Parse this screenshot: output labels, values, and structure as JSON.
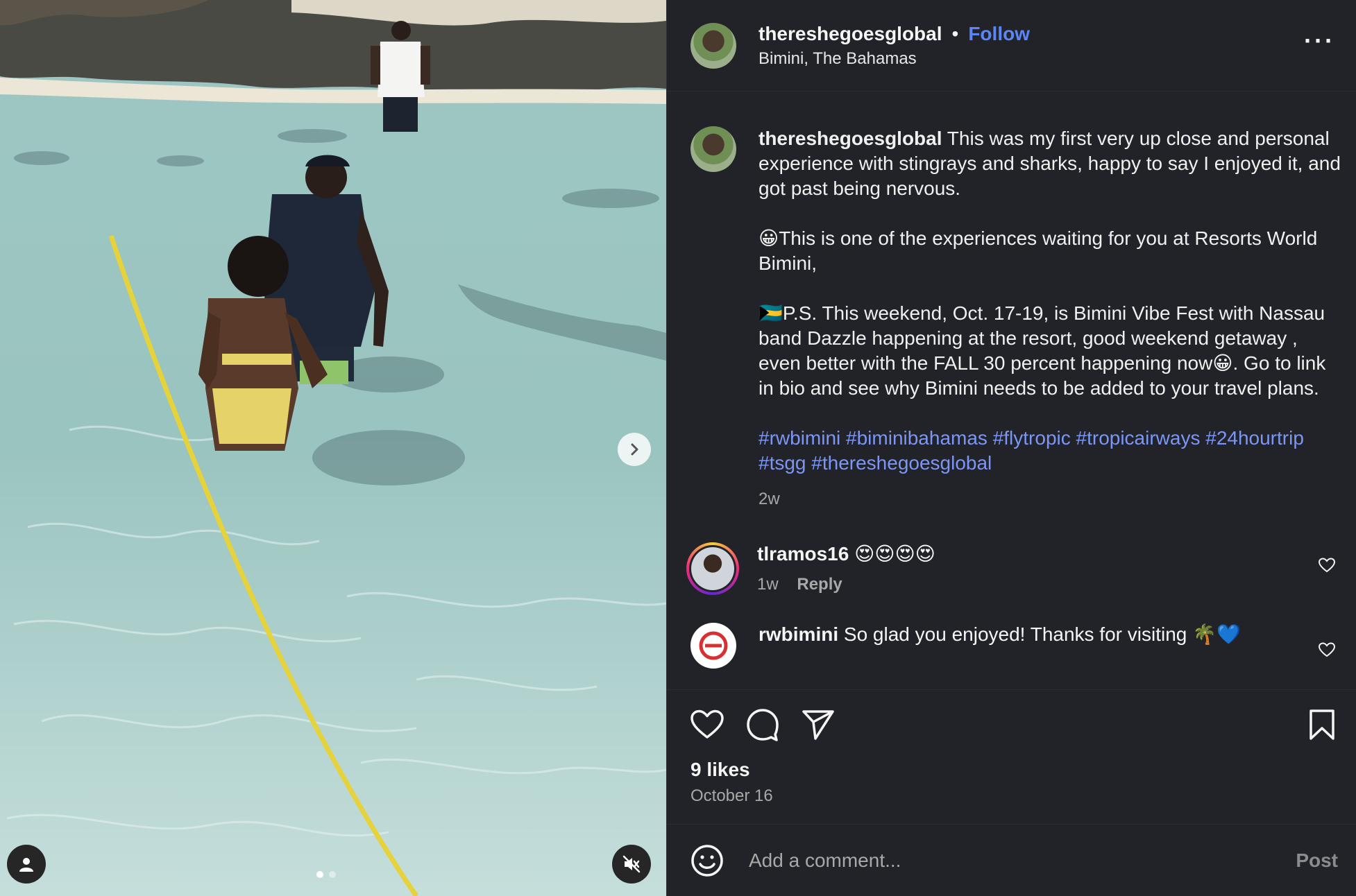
{
  "header": {
    "username": "thereshegoesglobal",
    "separator": "•",
    "follow_label": "Follow",
    "location": "Bimini, The Bahamas",
    "more_icon": "more-horizontal-icon"
  },
  "caption": {
    "username": "thereshegoesglobal",
    "p1": "This was my first very up close and personal experience with stingrays and sharks, happy to say I enjoyed it, and got past being nervous.",
    "p2": "😀This is one of the experiences waiting for you at Resorts World Bimini,",
    "p3": "🇧🇸P.S. This weekend, Oct. 17-19, is Bimini Vibe Fest with Nassau band Dazzle happening at the resort, good weekend getaway , even better with the FALL 30 percent happening now😀. Go to link in bio and see why Bimini needs to be added to your travel plans.",
    "hashtags": "#rwbimini #biminibahamas #flytropic #tropicairways #24hourtrip #tsgg #thereshegoesglobal",
    "time": "2w"
  },
  "comments": [
    {
      "username": "tlramos16",
      "text": "😍😍😍😍",
      "time": "1w",
      "reply_label": "Reply"
    },
    {
      "username": "rwbimini",
      "text": "So glad you enjoyed! Thanks for visiting 🌴💙"
    }
  ],
  "actions": {
    "like_icon": "heart-icon",
    "comment_icon": "comment-icon",
    "share_icon": "send-icon",
    "save_icon": "bookmark-icon"
  },
  "likes": "9 likes",
  "date": "October 16",
  "add_comment": {
    "placeholder": "Add a comment...",
    "post_label": "Post"
  },
  "media": {
    "carousel_count": 2,
    "carousel_active_index": 0
  },
  "colors": {
    "accent_link": "#5c86f5",
    "hashtag": "#7b96f6",
    "panel_bg": "#212328"
  }
}
